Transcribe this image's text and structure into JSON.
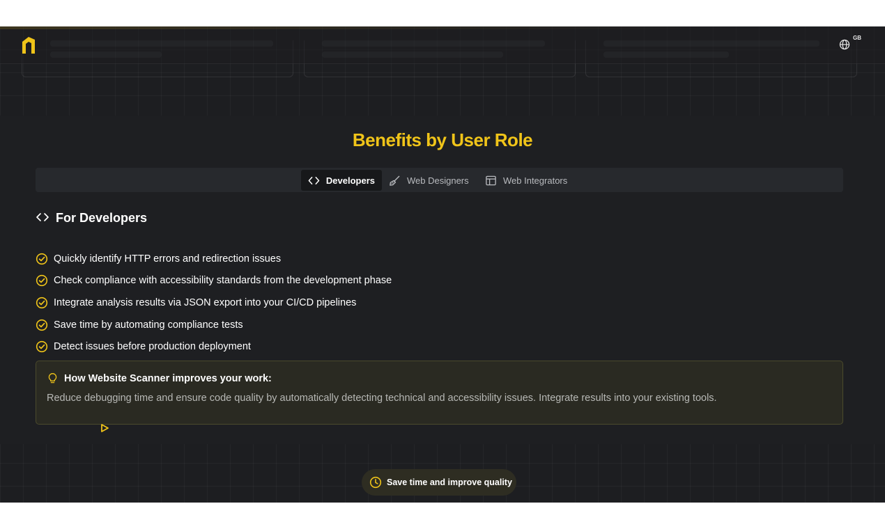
{
  "header": {
    "language_code": "GB",
    "icons": {
      "logo": "brand-logo",
      "language": "globe-icon"
    }
  },
  "section": {
    "title": "Benefits by User Role"
  },
  "tabs": [
    {
      "label": "Developers",
      "icon": "code-icon",
      "active": true
    },
    {
      "label": "Web Designers",
      "icon": "paintbrush-icon",
      "active": false
    },
    {
      "label": "Web Integrators",
      "icon": "layout-icon",
      "active": false
    }
  ],
  "panel": {
    "title": "For Developers",
    "benefits": [
      "Quickly identify HTTP errors and redirection issues",
      "Check compliance with accessibility standards from the development phase",
      "Integrate analysis results via JSON export into your CI/CD pipelines",
      "Save time by automating compliance tests",
      "Detect issues before production deployment"
    ],
    "info": {
      "title": "How Website Scanner improves your work:",
      "text": "Reduce debugging time and ensure code quality by automatically detecting technical and accessibility issues. Integrate results into your existing tools."
    }
  },
  "badge": {
    "label": "Save time and improve quality",
    "icon": "clock-icon"
  },
  "colors": {
    "accent": "#f0c419",
    "background": "#1d1e21",
    "tab_bar": "#27292d",
    "info_box": "#2a2a22"
  }
}
